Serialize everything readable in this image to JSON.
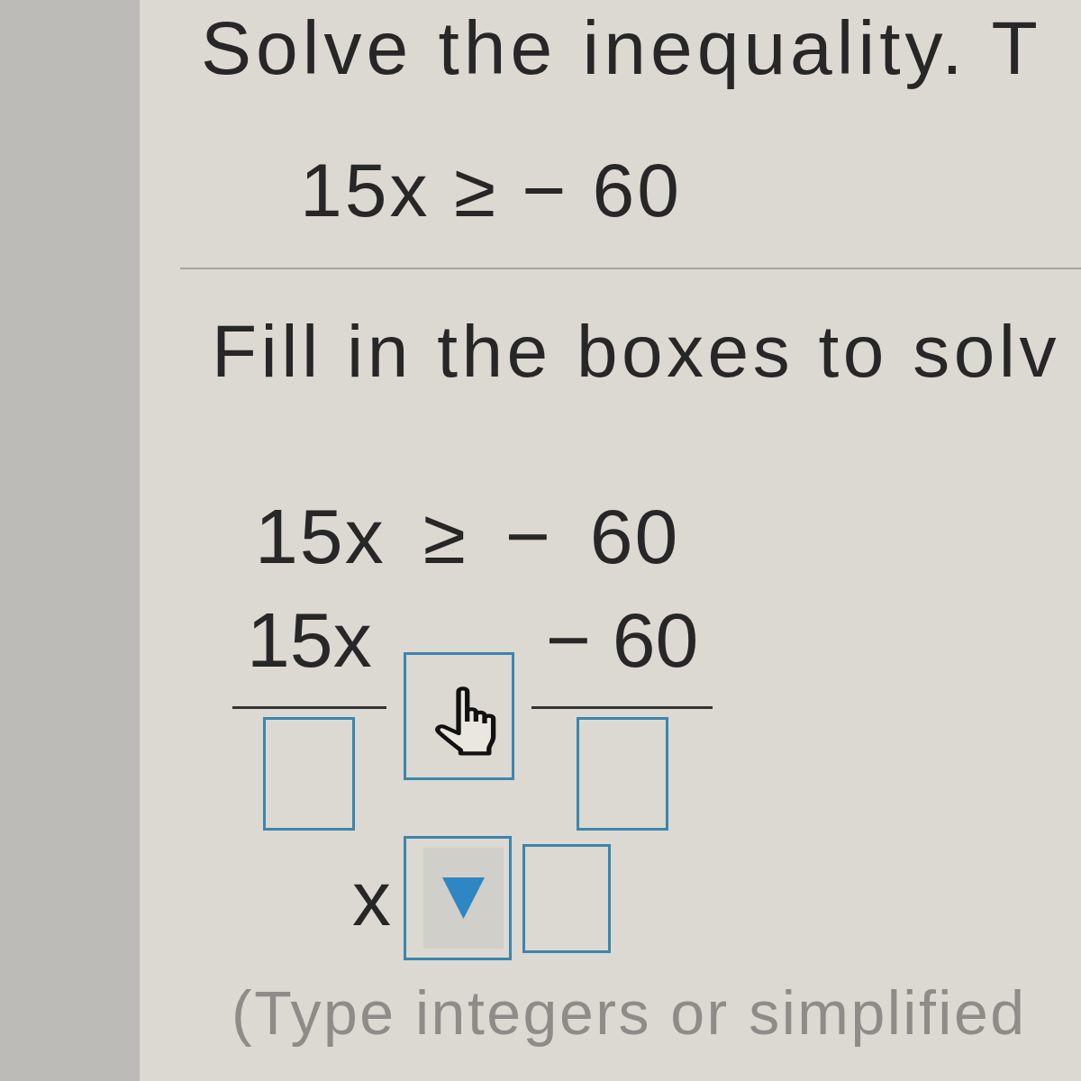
{
  "question": {
    "prompt": "Solve the inequality. T",
    "inequality": "15x ≥ − 60"
  },
  "instruction": "Fill in the boxes to solv",
  "work": {
    "rows": [
      {
        "items": [
          {
            "kind": "text",
            "text": "15x ≥ − 60"
          }
        ]
      },
      {
        "items": [
          {
            "kind": "fraction",
            "numerator": "15x"
          },
          {
            "kind": "box",
            "hovered": true
          },
          {
            "kind": "fraction",
            "numerator": "− 60"
          }
        ]
      },
      {
        "items": [
          {
            "kind": "text",
            "text": "x"
          },
          {
            "kind": "dropdown"
          },
          {
            "kind": "box",
            "hovered": false
          }
        ]
      }
    ]
  },
  "hint": "(Type integers or simplified"
}
